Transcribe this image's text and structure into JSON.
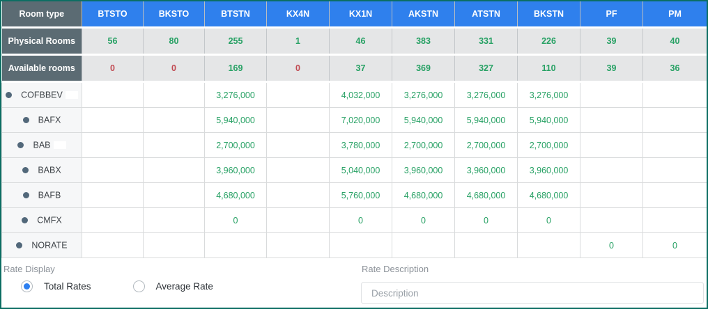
{
  "colors": {
    "frame_border": "#0c6e63",
    "header_blue": "#2f80ed",
    "label_slate": "#5b6b73",
    "summary_cell_bg": "#e5e6e7",
    "positive_green": "#27a164",
    "negative_red": "#c14a52",
    "bullet": "#52687a",
    "radio_selected_blue": "#2d7ff0"
  },
  "table": {
    "corner_label": "Room type",
    "columns": [
      "BTSTO",
      "BKSTO",
      "BTSTN",
      "KX4N",
      "KX1N",
      "AKSTN",
      "ATSTN",
      "BKSTN",
      "PF",
      "PM"
    ],
    "summary_rows": [
      {
        "label": "Physical Rooms",
        "zero_color": "green",
        "values": [
          "56",
          "80",
          "255",
          "1",
          "46",
          "383",
          "331",
          "226",
          "39",
          "40"
        ]
      },
      {
        "label": "Available rooms",
        "zero_color": "red",
        "values": [
          "0",
          "0",
          "169",
          "0",
          "37",
          "369",
          "327",
          "110",
          "39",
          "36"
        ]
      }
    ],
    "rate_rows": [
      {
        "code": "COFBBEV",
        "redacted": true,
        "values": [
          "",
          "",
          "3,276,000",
          "",
          "4,032,000",
          "3,276,000",
          "3,276,000",
          "3,276,000",
          "",
          ""
        ]
      },
      {
        "code": "BAFX",
        "redacted": false,
        "values": [
          "",
          "",
          "5,940,000",
          "",
          "7,020,000",
          "5,940,000",
          "5,940,000",
          "5,940,000",
          "",
          ""
        ]
      },
      {
        "code": "BAB",
        "redacted": true,
        "values": [
          "",
          "",
          "2,700,000",
          "",
          "3,780,000",
          "2,700,000",
          "2,700,000",
          "2,700,000",
          "",
          ""
        ]
      },
      {
        "code": "BABX",
        "redacted": false,
        "values": [
          "",
          "",
          "3,960,000",
          "",
          "5,040,000",
          "3,960,000",
          "3,960,000",
          "3,960,000",
          "",
          ""
        ]
      },
      {
        "code": "BAFB",
        "redacted": false,
        "values": [
          "",
          "",
          "4,680,000",
          "",
          "5,760,000",
          "4,680,000",
          "4,680,000",
          "4,680,000",
          "",
          ""
        ]
      },
      {
        "code": "CMFX",
        "redacted": false,
        "values": [
          "",
          "",
          "0",
          "",
          "0",
          "0",
          "0",
          "0",
          "",
          ""
        ]
      },
      {
        "code": "NORATE",
        "redacted": false,
        "values": [
          "",
          "",
          "",
          "",
          "",
          "",
          "",
          "",
          "0",
          "0"
        ]
      }
    ]
  },
  "footer": {
    "rate_display_label": "Rate Display",
    "options": [
      {
        "label": "Total Rates",
        "selected": true
      },
      {
        "label": "Average Rate",
        "selected": false
      }
    ],
    "rate_description_label": "Rate Description",
    "description_placeholder": "Description"
  }
}
